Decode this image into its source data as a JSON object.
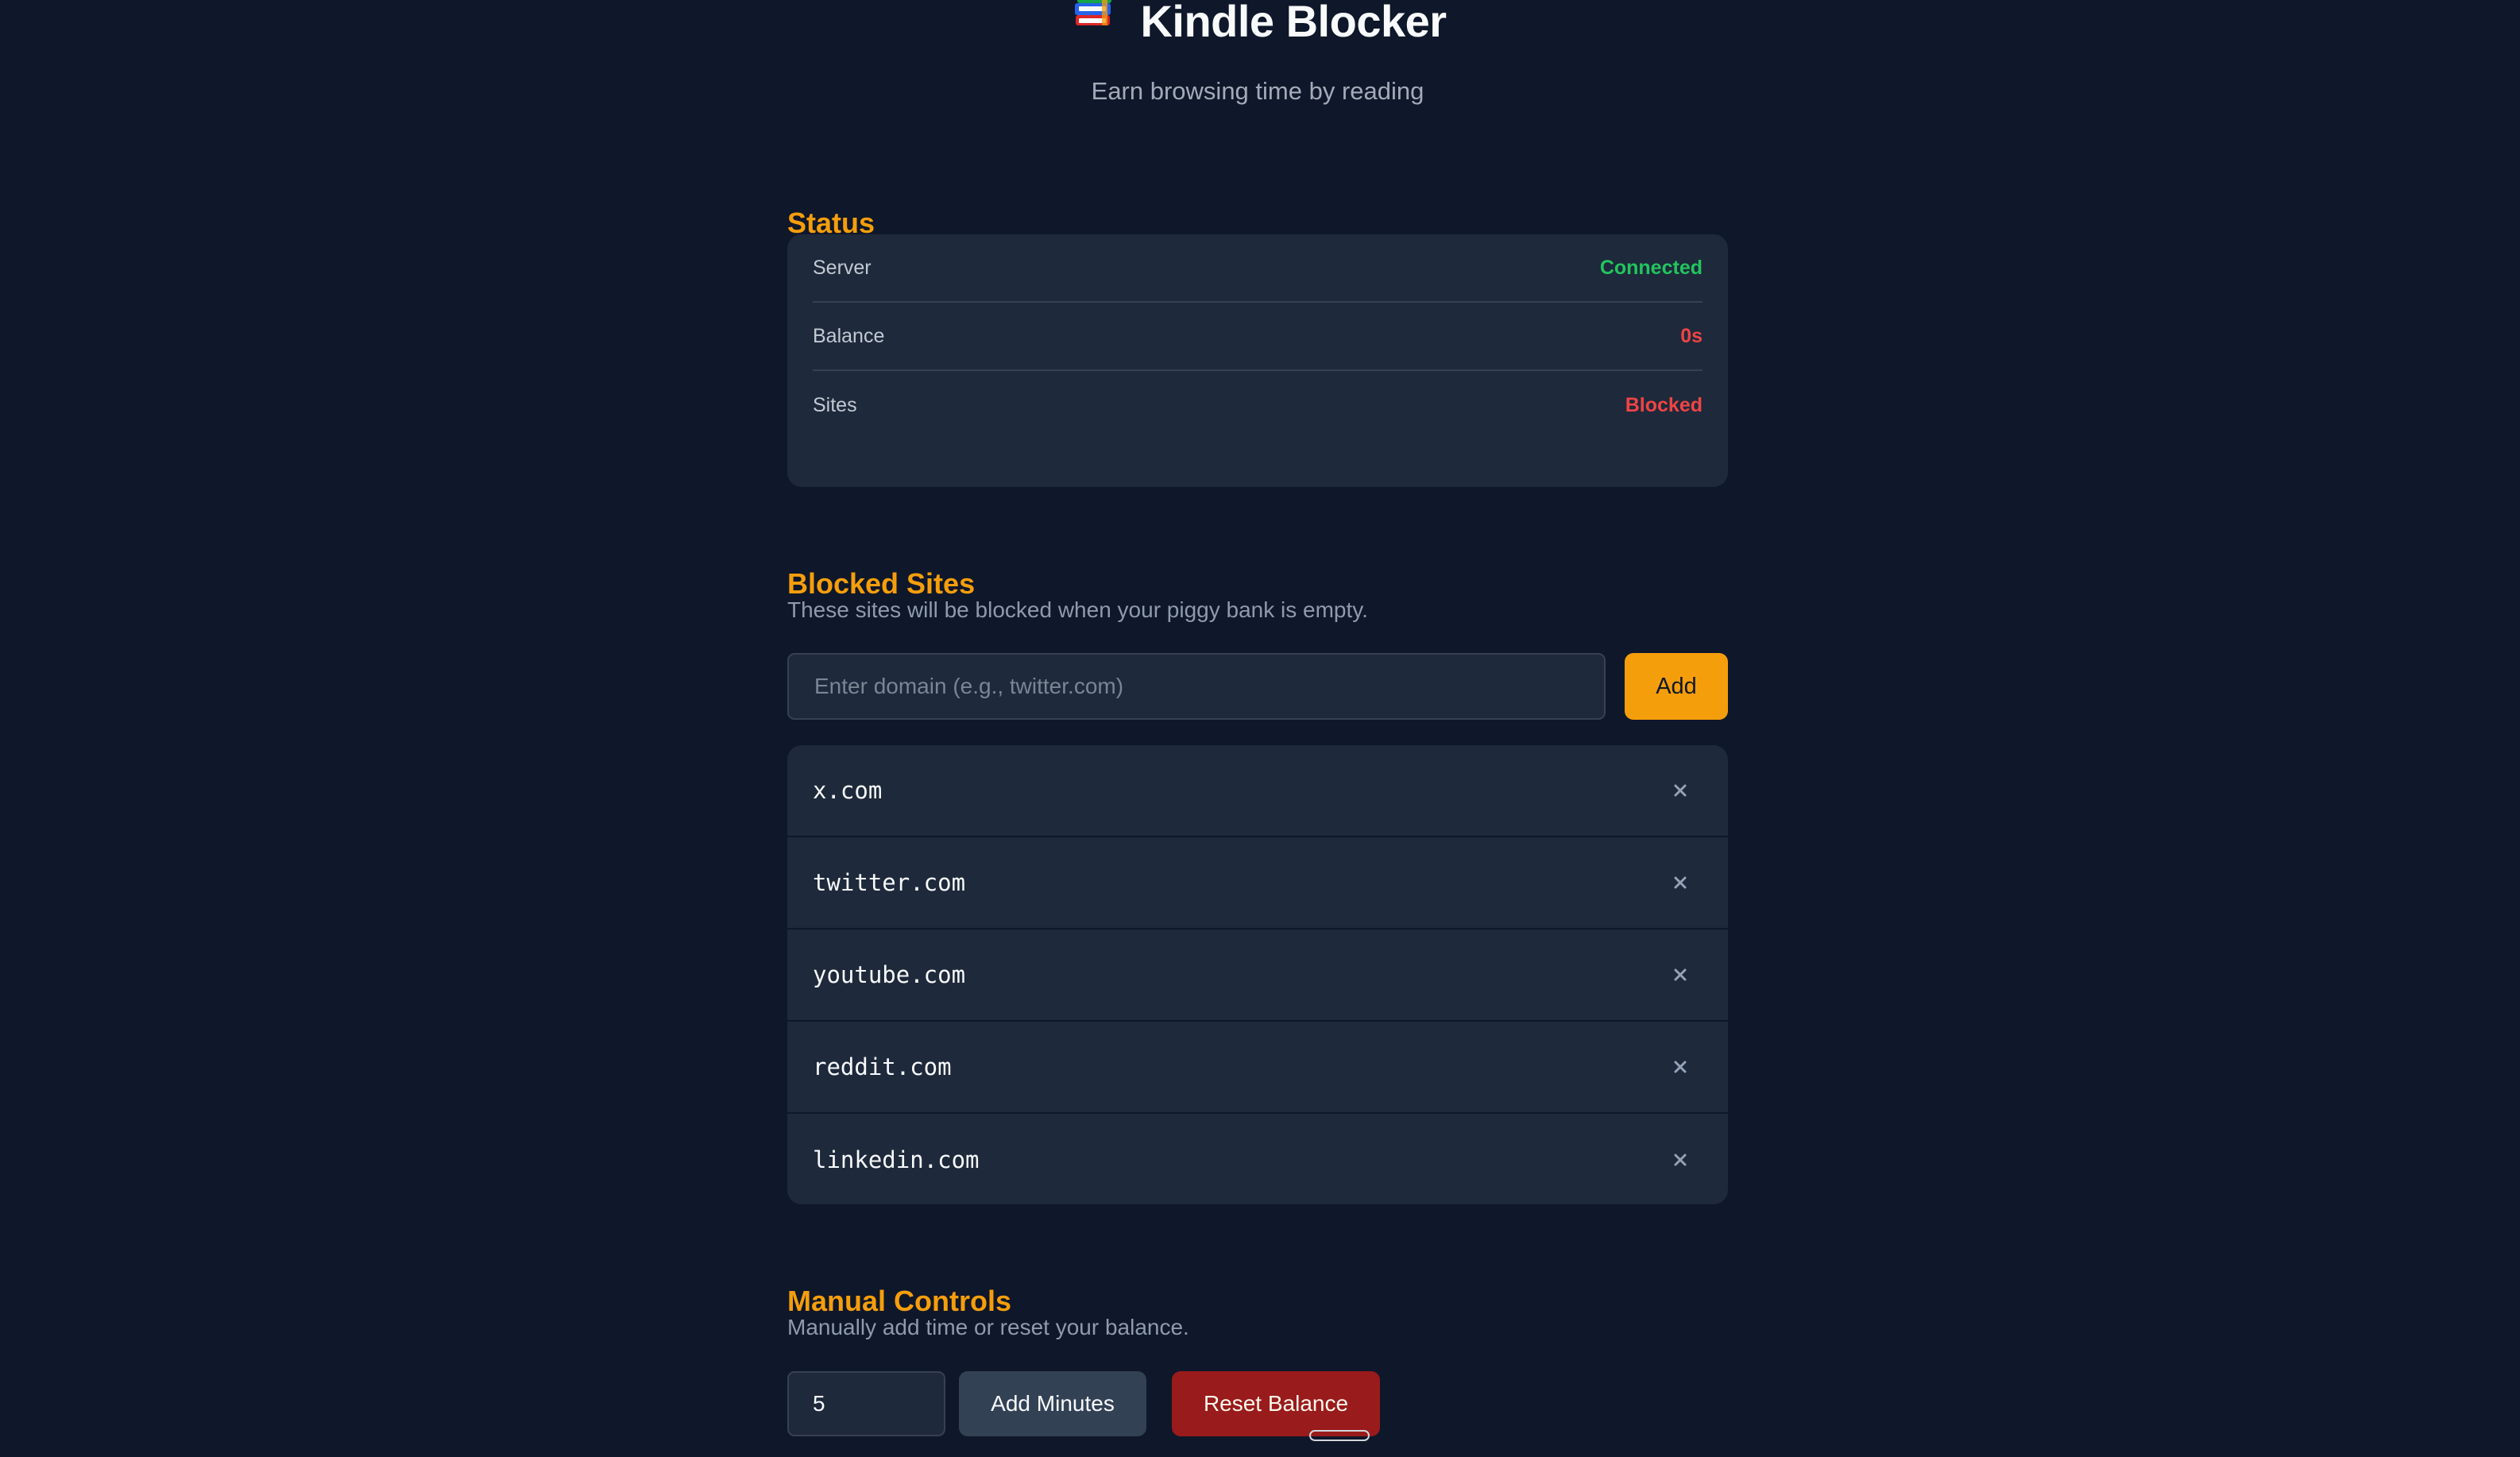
{
  "app": {
    "title": "Kindle Blocker",
    "subtitle": "Earn browsing time by reading",
    "icon": "books-icon"
  },
  "status": {
    "title": "Status",
    "rows": [
      {
        "label": "Server",
        "value": "Connected",
        "tone": "success"
      },
      {
        "label": "Balance",
        "value": "0s",
        "tone": "danger"
      },
      {
        "label": "Sites",
        "value": "Blocked",
        "tone": "danger"
      }
    ]
  },
  "blocked_sites": {
    "title": "Blocked Sites",
    "description": "These sites will be blocked when your piggy bank is empty.",
    "input_value": "",
    "input_placeholder": "Enter domain (e.g., twitter.com)",
    "add_label": "Add",
    "remove_icon": "close-icon",
    "sites": [
      "x.com",
      "twitter.com",
      "youtube.com",
      "reddit.com",
      "linkedin.com"
    ]
  },
  "manual_controls": {
    "title": "Manual Controls",
    "description": "Manually add time or reset your balance.",
    "minutes_value": "5",
    "add_minutes_label": "Add Minutes",
    "reset_label": "Reset Balance"
  },
  "colors": {
    "background": "#0f172a",
    "card": "#1e293b",
    "accent": "#f59e0b",
    "success": "#22c55e",
    "danger": "#ef4444",
    "reset_button": "#991b1b"
  }
}
